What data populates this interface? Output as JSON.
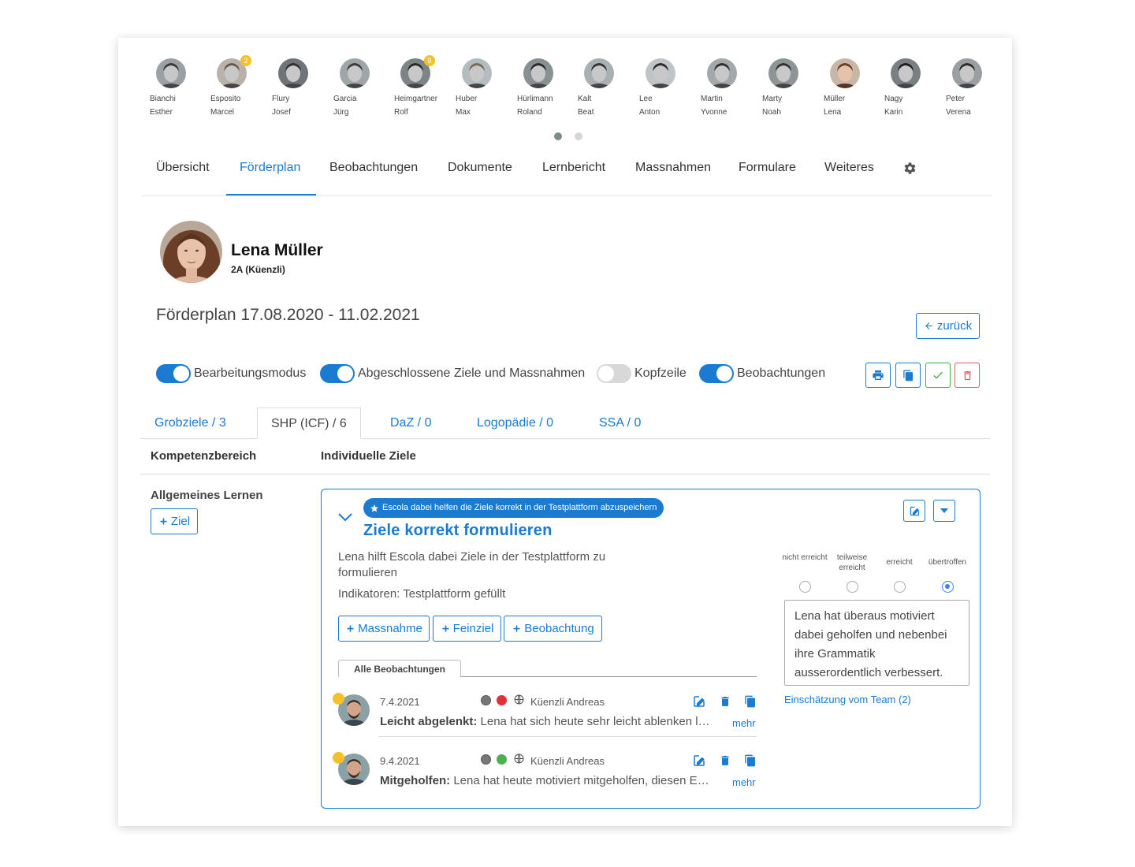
{
  "students": [
    {
      "last": "Bianchi",
      "first": "Esther",
      "badge": ""
    },
    {
      "last": "Esposito",
      "first": "Marcel",
      "badge": "2"
    },
    {
      "last": "Flury",
      "first": "Josef",
      "badge": ""
    },
    {
      "last": "Garcia",
      "first": "Jürg",
      "badge": ""
    },
    {
      "last": "Heimgartner",
      "first": "Rolf",
      "badge": "9"
    },
    {
      "last": "Huber",
      "first": "Max",
      "badge": ""
    },
    {
      "last": "Hürlimann",
      "first": "Roland",
      "badge": ""
    },
    {
      "last": "Kalt",
      "first": "Beat",
      "badge": ""
    },
    {
      "last": "Lee",
      "first": "Anton",
      "badge": ""
    },
    {
      "last": "Martin",
      "first": "Yvonne",
      "badge": ""
    },
    {
      "last": "Marty",
      "first": "Noah",
      "badge": ""
    },
    {
      "last": "Müller",
      "first": "Lena",
      "badge": ""
    },
    {
      "last": "Nagy",
      "first": "Karin",
      "badge": ""
    },
    {
      "last": "Peter",
      "first": "Verena",
      "badge": ""
    }
  ],
  "nav": {
    "items": [
      "Übersicht",
      "Förderplan",
      "Beobachtungen",
      "Dokumente",
      "Lernbericht",
      "Massnahmen",
      "Formulare",
      "Weiteres"
    ],
    "active": "Förderplan",
    "settings_icon": "gear-icon"
  },
  "profile": {
    "name": "Lena Müller",
    "class": "2A (Küenzli)"
  },
  "plan": {
    "title": "Förderplan 17.08.2020 - 11.02.2021",
    "back_label": "zurück"
  },
  "toggles": [
    {
      "label": "Bearbeitungsmodus",
      "on": true
    },
    {
      "label": "Abgeschlossene Ziele und Massnahmen",
      "on": true
    },
    {
      "label": "Kopfzeile",
      "on": false
    },
    {
      "label": "Beobachtungen",
      "on": true
    }
  ],
  "subtabs": [
    "Grobziele / 3",
    "SHP (ICF) / 6",
    "DaZ / 0",
    "Logopädie / 0",
    "SSA / 0"
  ],
  "columns": {
    "area": "Kompetenzbereich",
    "goals": "Individuelle Ziele"
  },
  "area": {
    "label": "Allgemeines Lernen",
    "add_goal": "Ziel"
  },
  "goal": {
    "pill": "Escola dabei helfen die Ziele korrekt in der Testplattform abzuspeichern",
    "title": "Ziele korrekt formulieren",
    "description": "Lena hilft Escola dabei Ziele in der Testplattform zu formulieren",
    "indicators": "Indikatoren:  Testplattform gefüllt",
    "buttons": [
      "Massnahme",
      "Feinziel",
      "Beobachtung"
    ],
    "obs_tab": "Alle Beobachtungen",
    "ratings": [
      "nicht erreicht",
      "teilweise erreicht",
      "erreicht",
      "übertroffen"
    ],
    "selected_rating": "übertroffen",
    "assessment": "Lena hat überaus motiviert dabei geholfen und nebenbei ihre Grammatik ausserordentlich verbessert.",
    "team_link": "Einschätzung vom Team (2)"
  },
  "observations": [
    {
      "date": "7.4.2021",
      "status_color": "#e0303a",
      "author": "Küenzli Andreas",
      "label": "Leicht abgelenkt:",
      "text": "Lena hat sich heute sehr leicht ablenken lassen und war oft unkonzentriert",
      "more": "mehr"
    },
    {
      "date": "9.4.2021",
      "status_color": "#4caf50",
      "author": "Küenzli Andreas",
      "label": "Mitgeholfen:",
      "text": "Lena hat heute motiviert mitgeholfen, diesen Eintrag zu erstellen",
      "more": "mehr"
    }
  ],
  "colors": {
    "accent": "#1a7bd0",
    "check": "#3aae3a",
    "delete": "#e05a5a",
    "badge": "#f5c02a"
  }
}
